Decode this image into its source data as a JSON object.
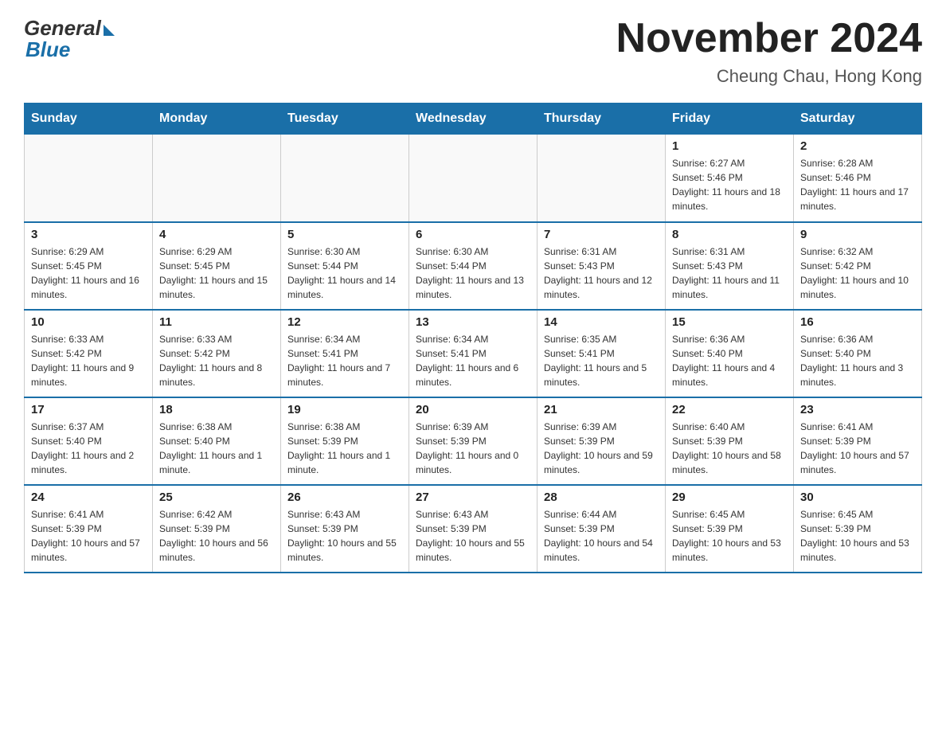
{
  "header": {
    "logo_general": "General",
    "logo_blue": "Blue",
    "title": "November 2024",
    "subtitle": "Cheung Chau, Hong Kong"
  },
  "days_of_week": [
    "Sunday",
    "Monday",
    "Tuesday",
    "Wednesday",
    "Thursday",
    "Friday",
    "Saturday"
  ],
  "weeks": [
    [
      {
        "day": "",
        "info": ""
      },
      {
        "day": "",
        "info": ""
      },
      {
        "day": "",
        "info": ""
      },
      {
        "day": "",
        "info": ""
      },
      {
        "day": "",
        "info": ""
      },
      {
        "day": "1",
        "info": "Sunrise: 6:27 AM\nSunset: 5:46 PM\nDaylight: 11 hours and 18 minutes."
      },
      {
        "day": "2",
        "info": "Sunrise: 6:28 AM\nSunset: 5:46 PM\nDaylight: 11 hours and 17 minutes."
      }
    ],
    [
      {
        "day": "3",
        "info": "Sunrise: 6:29 AM\nSunset: 5:45 PM\nDaylight: 11 hours and 16 minutes."
      },
      {
        "day": "4",
        "info": "Sunrise: 6:29 AM\nSunset: 5:45 PM\nDaylight: 11 hours and 15 minutes."
      },
      {
        "day": "5",
        "info": "Sunrise: 6:30 AM\nSunset: 5:44 PM\nDaylight: 11 hours and 14 minutes."
      },
      {
        "day": "6",
        "info": "Sunrise: 6:30 AM\nSunset: 5:44 PM\nDaylight: 11 hours and 13 minutes."
      },
      {
        "day": "7",
        "info": "Sunrise: 6:31 AM\nSunset: 5:43 PM\nDaylight: 11 hours and 12 minutes."
      },
      {
        "day": "8",
        "info": "Sunrise: 6:31 AM\nSunset: 5:43 PM\nDaylight: 11 hours and 11 minutes."
      },
      {
        "day": "9",
        "info": "Sunrise: 6:32 AM\nSunset: 5:42 PM\nDaylight: 11 hours and 10 minutes."
      }
    ],
    [
      {
        "day": "10",
        "info": "Sunrise: 6:33 AM\nSunset: 5:42 PM\nDaylight: 11 hours and 9 minutes."
      },
      {
        "day": "11",
        "info": "Sunrise: 6:33 AM\nSunset: 5:42 PM\nDaylight: 11 hours and 8 minutes."
      },
      {
        "day": "12",
        "info": "Sunrise: 6:34 AM\nSunset: 5:41 PM\nDaylight: 11 hours and 7 minutes."
      },
      {
        "day": "13",
        "info": "Sunrise: 6:34 AM\nSunset: 5:41 PM\nDaylight: 11 hours and 6 minutes."
      },
      {
        "day": "14",
        "info": "Sunrise: 6:35 AM\nSunset: 5:41 PM\nDaylight: 11 hours and 5 minutes."
      },
      {
        "day": "15",
        "info": "Sunrise: 6:36 AM\nSunset: 5:40 PM\nDaylight: 11 hours and 4 minutes."
      },
      {
        "day": "16",
        "info": "Sunrise: 6:36 AM\nSunset: 5:40 PM\nDaylight: 11 hours and 3 minutes."
      }
    ],
    [
      {
        "day": "17",
        "info": "Sunrise: 6:37 AM\nSunset: 5:40 PM\nDaylight: 11 hours and 2 minutes."
      },
      {
        "day": "18",
        "info": "Sunrise: 6:38 AM\nSunset: 5:40 PM\nDaylight: 11 hours and 1 minute."
      },
      {
        "day": "19",
        "info": "Sunrise: 6:38 AM\nSunset: 5:39 PM\nDaylight: 11 hours and 1 minute."
      },
      {
        "day": "20",
        "info": "Sunrise: 6:39 AM\nSunset: 5:39 PM\nDaylight: 11 hours and 0 minutes."
      },
      {
        "day": "21",
        "info": "Sunrise: 6:39 AM\nSunset: 5:39 PM\nDaylight: 10 hours and 59 minutes."
      },
      {
        "day": "22",
        "info": "Sunrise: 6:40 AM\nSunset: 5:39 PM\nDaylight: 10 hours and 58 minutes."
      },
      {
        "day": "23",
        "info": "Sunrise: 6:41 AM\nSunset: 5:39 PM\nDaylight: 10 hours and 57 minutes."
      }
    ],
    [
      {
        "day": "24",
        "info": "Sunrise: 6:41 AM\nSunset: 5:39 PM\nDaylight: 10 hours and 57 minutes."
      },
      {
        "day": "25",
        "info": "Sunrise: 6:42 AM\nSunset: 5:39 PM\nDaylight: 10 hours and 56 minutes."
      },
      {
        "day": "26",
        "info": "Sunrise: 6:43 AM\nSunset: 5:39 PM\nDaylight: 10 hours and 55 minutes."
      },
      {
        "day": "27",
        "info": "Sunrise: 6:43 AM\nSunset: 5:39 PM\nDaylight: 10 hours and 55 minutes."
      },
      {
        "day": "28",
        "info": "Sunrise: 6:44 AM\nSunset: 5:39 PM\nDaylight: 10 hours and 54 minutes."
      },
      {
        "day": "29",
        "info": "Sunrise: 6:45 AM\nSunset: 5:39 PM\nDaylight: 10 hours and 53 minutes."
      },
      {
        "day": "30",
        "info": "Sunrise: 6:45 AM\nSunset: 5:39 PM\nDaylight: 10 hours and 53 minutes."
      }
    ]
  ]
}
